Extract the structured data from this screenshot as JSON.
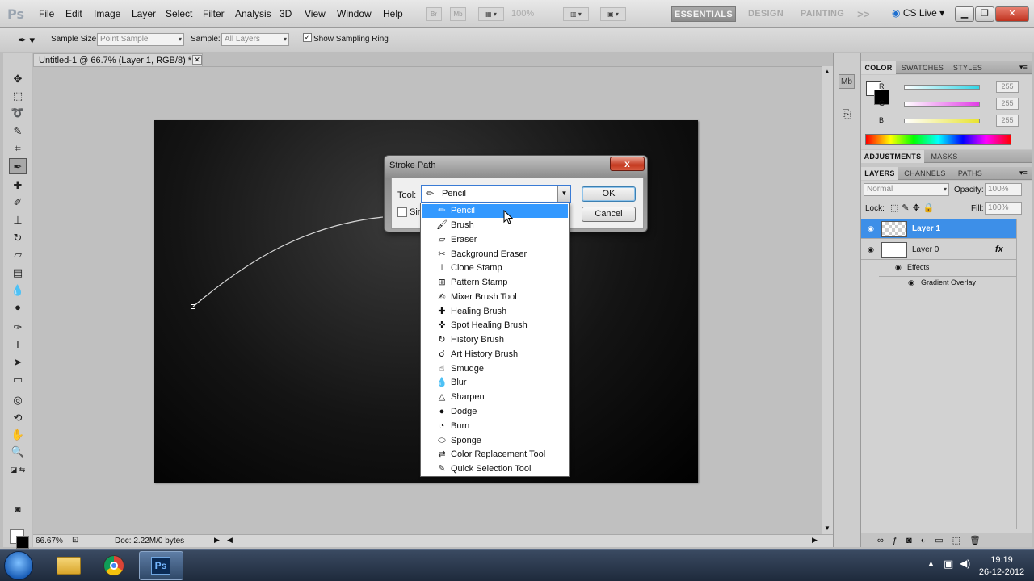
{
  "app": {
    "logo": "Ps",
    "menu": [
      "File",
      "Edit",
      "Image",
      "Layer",
      "Select",
      "Filter",
      "Analysis",
      "3D",
      "View",
      "Window",
      "Help"
    ],
    "zoom_display": "100%",
    "workspaces": [
      "ESSENTIALS",
      "DESIGN",
      "PAINTING"
    ],
    "more_workspaces": ">>",
    "cs_live": "CS Live"
  },
  "options": {
    "sample_size_label": "Sample Size:",
    "sample_size_value": "Point Sample",
    "sample_label": "Sample:",
    "sample_value": "All Layers",
    "show_ring_label": "Show Sampling Ring",
    "show_ring_checked": true
  },
  "document": {
    "tab_title": "Untitled-1 @ 66.7% (Layer 1, RGB/8) *",
    "status_zoom": "66.67%",
    "status_doc": "Doc: 2.22M/0 bytes"
  },
  "color_panel": {
    "tabs": [
      "COLOR",
      "SWATCHES",
      "STYLES"
    ],
    "channels": [
      {
        "name": "R",
        "value": "255",
        "color": "#31d5e6"
      },
      {
        "name": "G",
        "value": "255",
        "color": "#e23ee6"
      },
      {
        "name": "B",
        "value": "255",
        "color": "#e8e330"
      }
    ]
  },
  "adjustments_panel": {
    "tabs": [
      "ADJUSTMENTS",
      "MASKS"
    ]
  },
  "layers_panel": {
    "tabs": [
      "LAYERS",
      "CHANNELS",
      "PATHS"
    ],
    "blend_mode": "Normal",
    "opacity_label": "Opacity:",
    "opacity_value": "100%",
    "lock_label": "Lock:",
    "fill_label": "Fill:",
    "fill_value": "100%",
    "layers": [
      {
        "name": "Layer 1",
        "selected": true
      },
      {
        "name": "Layer 0",
        "selected": false
      }
    ],
    "effects_label": "Effects",
    "effect_item": "Gradient Overlay",
    "fx_badge": "fx"
  },
  "dialog": {
    "title": "Stroke Path",
    "tool_label": "Tool:",
    "tool_value": "Pencil",
    "simulate_label": "Sim",
    "ok_label": "OK",
    "cancel_label": "Cancel",
    "close_label": "x"
  },
  "tool_options": [
    {
      "label": "Pencil",
      "icon": "pencil-icon",
      "selected": true
    },
    {
      "label": "Brush",
      "icon": "brush-icon"
    },
    {
      "label": "Eraser",
      "icon": "eraser-icon"
    },
    {
      "label": "Background Eraser",
      "icon": "background-eraser-icon"
    },
    {
      "label": "Clone Stamp",
      "icon": "clone-stamp-icon"
    },
    {
      "label": "Pattern Stamp",
      "icon": "pattern-stamp-icon"
    },
    {
      "label": "Mixer Brush Tool",
      "icon": "mixer-brush-icon"
    },
    {
      "label": "Healing Brush",
      "icon": "healing-brush-icon"
    },
    {
      "label": "Spot Healing Brush",
      "icon": "spot-healing-brush-icon"
    },
    {
      "label": "History Brush",
      "icon": "history-brush-icon"
    },
    {
      "label": "Art History Brush",
      "icon": "art-history-brush-icon"
    },
    {
      "label": "Smudge",
      "icon": "smudge-icon"
    },
    {
      "label": "Blur",
      "icon": "blur-icon"
    },
    {
      "label": "Sharpen",
      "icon": "sharpen-icon"
    },
    {
      "label": "Dodge",
      "icon": "dodge-icon"
    },
    {
      "label": "Burn",
      "icon": "burn-icon"
    },
    {
      "label": "Sponge",
      "icon": "sponge-icon"
    },
    {
      "label": "Color Replacement Tool",
      "icon": "color-replacement-icon"
    },
    {
      "label": "Quick Selection Tool",
      "icon": "quick-selection-icon"
    }
  ],
  "taskbar": {
    "time": "19:19",
    "date": "26-12-2012",
    "ps_label": "Ps"
  }
}
